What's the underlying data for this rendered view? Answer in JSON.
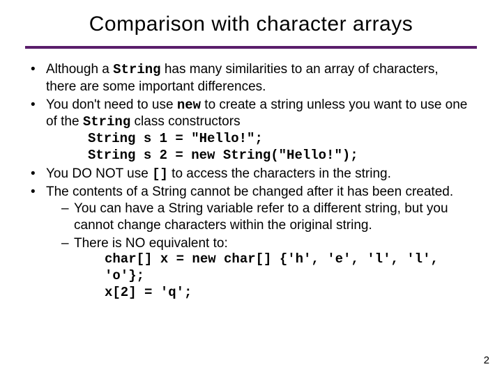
{
  "title": "Comparison with character arrays",
  "bullets": {
    "b1a": "Although a ",
    "b1_code": "String",
    "b1b": " has many similarities to an array of characters, there are some important differences.",
    "b2a": "You don't need to use ",
    "b2_code1": "new",
    "b2b": " to create a string unless you want to use one of the ",
    "b2_code2": "String",
    "b2c": " class constructors",
    "b2_codeblock_l1": "String s 1 = \"Hello!\";",
    "b2_codeblock_l2": "String s 2 = new String(\"Hello!\");",
    "b3a": "You DO NOT use ",
    "b3_code": "[]",
    "b3b": " to access the characters in the string.",
    "b4": "The contents of a String cannot be changed after it has been created.",
    "b4_s1": "You can have a String variable refer to a different string, but you cannot change characters within the original string.",
    "b4_s2": "There is NO equivalent to:",
    "b4_codeblock_l1": "char[] x = new char[] {'h', 'e', 'l', 'l', 'o'};",
    "b4_codeblock_l2": "x[2] = 'q';"
  },
  "pagenum": "2"
}
